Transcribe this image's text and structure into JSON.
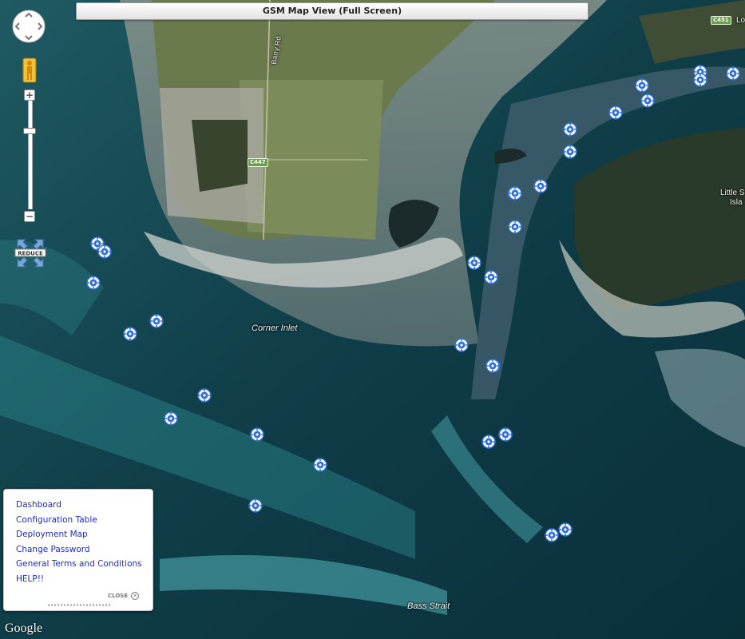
{
  "title": "GSM Map View (Full Screen)",
  "controls": {
    "zoom_in": "+",
    "zoom_out": "−",
    "reduce_label": "REDUCE"
  },
  "map_labels": {
    "road_barry": "Barry Rd",
    "shield_c447": "C447",
    "shield_c451": "C451",
    "corner_inlet": "Corner Inlet",
    "little_snake_1": "Little S",
    "little_snake_2": "Isla",
    "bass_strait": "Bass Strait",
    "edge_label": "Lo"
  },
  "markers_count": 34,
  "nav_links": [
    "Dashboard",
    "Configuration Table",
    "Deployment Map",
    "Change Password",
    "General Terms and Conditions",
    "HELP!!"
  ],
  "close_label": "CLOSE",
  "attribution": "Google",
  "colors": {
    "link": "#1d2bd6",
    "marker": "#2e6fd8",
    "road_shield": "#6aa04a"
  }
}
